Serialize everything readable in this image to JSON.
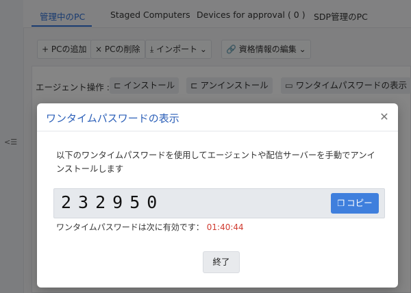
{
  "tabs": [
    {
      "label": "管理中のPC"
    },
    {
      "label": "Staged Computers"
    },
    {
      "label": "Devices for approval ( 0 )"
    },
    {
      "label": "SDP管理のPC"
    }
  ],
  "toolbar": {
    "add_pc": "+ PCの追加",
    "delete_pc": "× PCの削除",
    "import": "⤓ インポート ⌄",
    "edit_credentials": "🔗 資格情報の編集 ⌄"
  },
  "agent_actions": {
    "label": "エージェント操作 :",
    "install": "⊏ インストール",
    "uninstall": "⊏ アンインストール",
    "show_otp": "▭ ワンタイムパスワードの表示"
  },
  "modal": {
    "title": "ワンタイムパスワードの表示",
    "description": "以下のワンタイムパスワードを使用してエージェントや配信サーバーを手動でアンインストールします",
    "otp": "232950",
    "copy_label": "コピー",
    "validity_label": "ワンタイムパスワードは次に有効です：",
    "validity_time": "01:40:44",
    "close_label": "終了"
  },
  "colors": {
    "accent": "#2f6fd6",
    "primary_button": "#3f7fdd",
    "expiry_time": "#d03b30"
  },
  "icons": {
    "sidebar_toggle": "collapse-sidebar-icon",
    "copy": "copy-icon",
    "close": "close-icon"
  }
}
